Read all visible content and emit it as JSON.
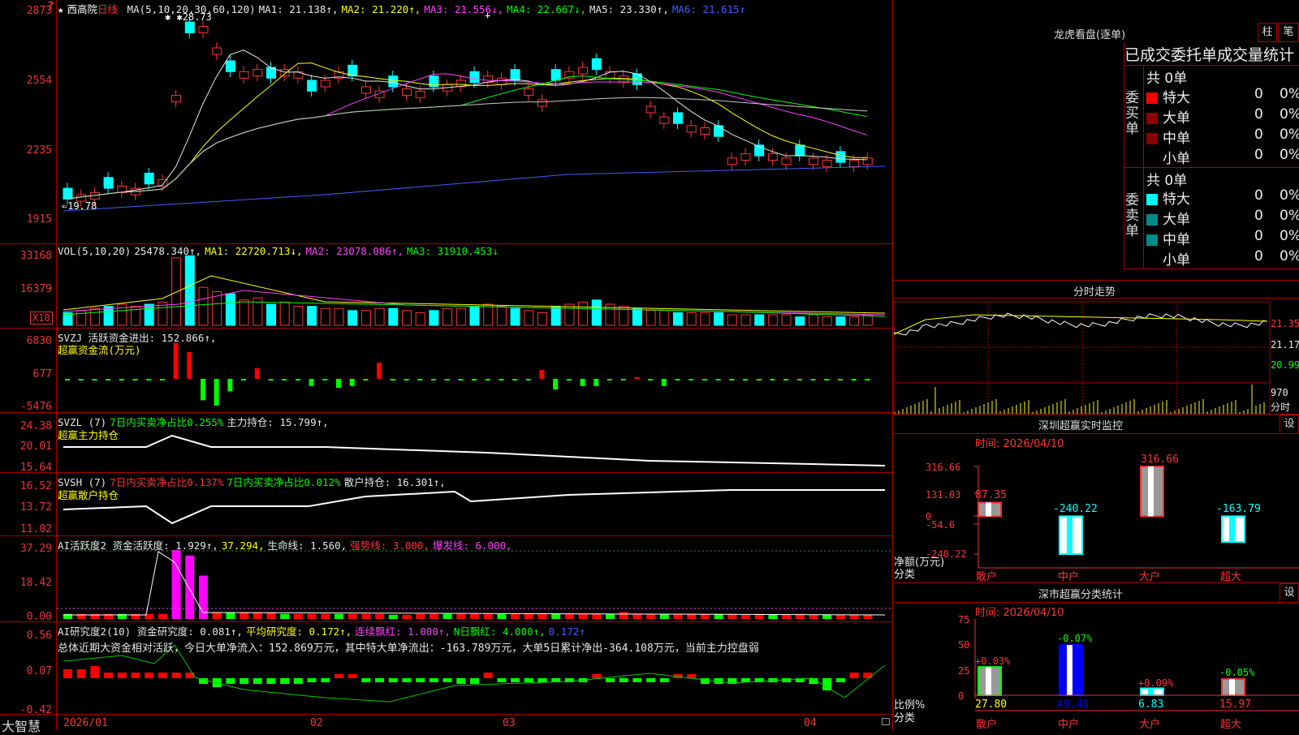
{
  "stock": {
    "star": "★",
    "name": "西高院",
    "period": "日线"
  },
  "main": {
    "ylabels": [
      "2873",
      "2554",
      "2235",
      "1915"
    ],
    "ma_header": [
      {
        "t": "MA(5,10,20,30,60,120)",
        "c": "#e8e8e8"
      },
      {
        "t": "MA1: 21.138↑,",
        "c": "#e8e8e8"
      },
      {
        "t": "MA2: 21.220↑,",
        "c": "#ffff00"
      },
      {
        "t": "MA3: 21.556↓,",
        "c": "#ff40ff"
      },
      {
        "t": "MA4: 22.667↓,",
        "c": "#00ff00"
      },
      {
        "t": "MA5: 23.330↑,",
        "c": "#e8e8e8"
      },
      {
        "t": "MA6: 21.615↑",
        "c": "#4060ff"
      }
    ],
    "high_mark": "28.73",
    "low_mark": "19.78",
    "question_mark": "?",
    "plus_mark": "+"
  },
  "vol": {
    "ylabels": [
      "33168",
      "16379"
    ],
    "x10": "X10",
    "header": [
      {
        "t": "VOL(5,10,20)",
        "c": "#e8e8e8"
      },
      {
        "t": "25478.340↑,",
        "c": "#e8e8e8"
      },
      {
        "t": "MA1: 22720.713↓,",
        "c": "#ffff00"
      },
      {
        "t": "MA2: 23078.086↑,",
        "c": "#ff40ff"
      },
      {
        "t": "MA3: 31910.453↓",
        "c": "#00ff00"
      }
    ]
  },
  "svzj": {
    "ylabels": [
      "6830",
      "677",
      "-5476"
    ],
    "header": [
      {
        "t": "SVZJ  活跃资金进出: 152.866↑,",
        "c": "#e8e8e8"
      }
    ],
    "sub": "超赢资金流(万元)"
  },
  "svzl": {
    "ylabels": [
      "24.38",
      "20.01",
      "15.64"
    ],
    "header": [
      {
        "t": "SVZL (7)",
        "c": "#e8e8e8"
      },
      {
        "t": "7日内买卖净占比0.255%",
        "c": "#00ff00"
      },
      {
        "t": "主力持仓: 15.799↑,",
        "c": "#e8e8e8"
      }
    ],
    "sub": "超赢主力持仓"
  },
  "svsh": {
    "ylabels": [
      "16.52",
      "13.72",
      "11.02"
    ],
    "header": [
      {
        "t": "SVSH (7)",
        "c": "#e8e8e8"
      },
      {
        "t": "7日内买卖净占比0.137%",
        "c": "#ff3333"
      },
      {
        "t": "7日内买卖净占比0.012%",
        "c": "#00ff00"
      },
      {
        "t": "散户持仓: 16.301↑,",
        "c": "#e8e8e8"
      }
    ],
    "sub": "超赢散户持仓"
  },
  "ai1": {
    "ylabels": [
      "37.29",
      "18.42",
      "0.00"
    ],
    "header": [
      {
        "t": "AI活跃度2 资金活跃度: 1.929↑,",
        "c": "#e8e8e8"
      },
      {
        "t": "37.294,",
        "c": "#ffff00"
      },
      {
        "t": "生命线: 1.560,",
        "c": "#e8e8e8"
      },
      {
        "t": "强势线: 3.000,",
        "c": "#ff3333"
      },
      {
        "t": "爆发线: 6.000,",
        "c": "#ff40ff"
      }
    ]
  },
  "ai2": {
    "ylabels": [
      "0.56",
      "0.07",
      "-0.42"
    ],
    "header": [
      {
        "t": "AI研究度2(10) 资金研究度: 0.081↑,",
        "c": "#e8e8e8"
      },
      {
        "t": "平均研究度: 0.172↑,",
        "c": "#ffff00"
      },
      {
        "t": "连续飘红: 1.000↑,",
        "c": "#ff40ff"
      },
      {
        "t": "N日飘红: 4.000↑,",
        "c": "#00ff00"
      },
      {
        "t": "0.172↑",
        "c": "#4060ff"
      }
    ],
    "summary": "总体近期大资金相对活跃，今日大单净流入：152.869万元，其中特大单净流出：-163.789万元，大单5日累计净出-364.108万元，当前主力控盘弱"
  },
  "xaxis": {
    "brand": "大智慧",
    "labels": [
      "2026/01",
      "02",
      "03",
      "04"
    ]
  },
  "lhb": {
    "title": "龙虎看盘(逐单)",
    "btn1": "柱",
    "btn2": "笔",
    "subtitle": "已成交委托单成交量统计",
    "buy_side": "委买单",
    "sell_side": "委卖单",
    "buy_total": "共 0单",
    "sell_total": "共 0单",
    "buy_rows": [
      {
        "label": "特大",
        "val": "0",
        "pct": "0%",
        "color": "#ff0000"
      },
      {
        "label": "大单",
        "val": "0",
        "pct": "0%",
        "color": "#8b0000"
      },
      {
        "label": "中单",
        "val": "0",
        "pct": "0%",
        "color": "#8b0000"
      },
      {
        "label": "小单",
        "val": "0",
        "pct": "0%",
        "color": ""
      }
    ],
    "sell_rows": [
      {
        "label": "特大",
        "val": "0",
        "pct": "0%",
        "color": "#00ffff"
      },
      {
        "label": "大单",
        "val": "0",
        "pct": "0%",
        "color": "#008b8b"
      },
      {
        "label": "中单",
        "val": "0",
        "pct": "0%",
        "color": "#008b8b"
      },
      {
        "label": "小单",
        "val": "0",
        "pct": "0%",
        "color": ""
      }
    ]
  },
  "intraday": {
    "title": "分时走势",
    "prices": [
      "21.35",
      "21.17",
      "20.99"
    ],
    "vol": "970",
    "vol_unit": "分时"
  },
  "monitor": {
    "title": "深圳超赢实时监控",
    "btn": "设",
    "time": "时间: 2026/04/10",
    "ylabels": [
      "316.66",
      "131.03",
      "0",
      "-54.6",
      "-240.22"
    ],
    "ylabel_title": "净额(万元)",
    "x_title": "分类",
    "chart_data": {
      "type": "bar",
      "categories": [
        "散户",
        "中户",
        "大户",
        "超大"
      ],
      "values": [
        87.35,
        -240.22,
        316.66,
        -163.79
      ],
      "ylim": [
        -240.22,
        316.66
      ]
    },
    "value_labels": [
      "87.35",
      "-240.22",
      "316.66",
      "-163.79"
    ]
  },
  "classify": {
    "title": "深市超赢分类统计",
    "btn": "设",
    "time": "时间: 2026/04/10",
    "ylabels": [
      "75",
      "50",
      "25",
      "0"
    ],
    "ylabel_title": "比例%",
    "x_title": "分类",
    "chart_data": {
      "type": "bar",
      "categories": [
        "散户",
        "中户",
        "大户",
        "超大"
      ],
      "values": [
        27.8,
        49.4,
        6.83,
        15.97
      ],
      "changes": [
        "+0.03%",
        "-0.07%",
        "+0.09%",
        "-0.05%"
      ],
      "ylim": [
        0,
        75
      ]
    },
    "value_labels": [
      "27.80",
      "49.40",
      "6.83",
      "15.97"
    ]
  }
}
